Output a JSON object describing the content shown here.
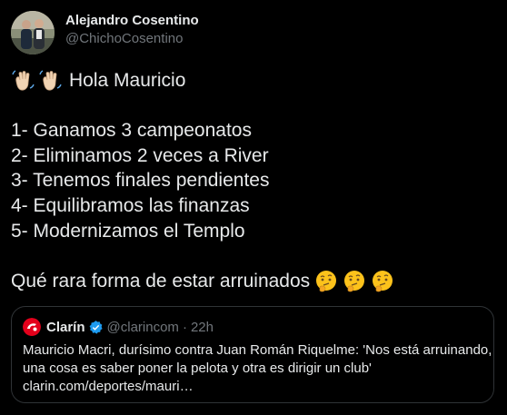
{
  "author": {
    "name": "Alejandro Cosentino",
    "handle": "@ChichoCosentino"
  },
  "tweet": {
    "greeting_emoji": "waving-hand-icon",
    "greeting": "Hola Mauricio",
    "items": [
      "1- Ganamos 3 campeonatos",
      "2- Eliminamos 2 veces a River",
      "3- Tenemos finales pendientes",
      "4- Equilibramos las finanzas",
      "5- Modernizamos el Templo"
    ],
    "closing": "Qué rara forma de estar arruinados",
    "closing_emoji": "thinking-face-icon"
  },
  "quote": {
    "name": "Clarín",
    "handle": "@clarincom",
    "separator": "·",
    "time": "22h",
    "text_lines": [
      "Mauricio Macri, durísimo contra Juan Román Riquelme: 'Nos está arruinando,",
      "una cosa es saber poner la pelota y otra es dirigir un club'",
      "clarin.com/deportes/mauri…"
    ]
  },
  "colors": {
    "background": "#000000",
    "text": "#e7e9ea",
    "secondary_text": "#71767b",
    "border": "#2f3336",
    "verified_blue": "#1d9bf0",
    "clarin_red": "#e3001b"
  }
}
